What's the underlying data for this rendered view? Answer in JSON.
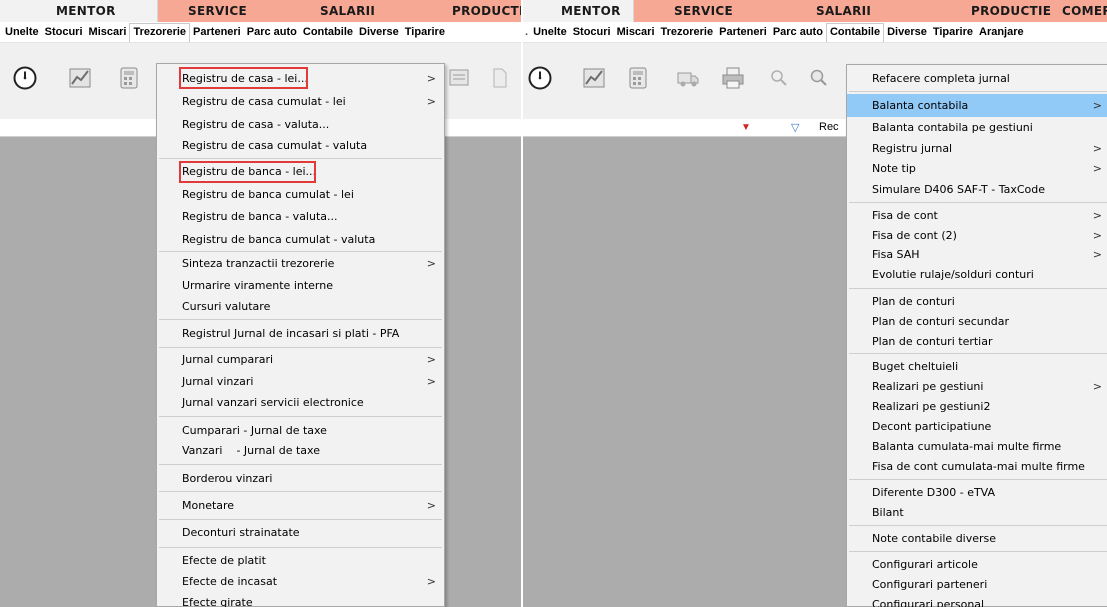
{
  "left": {
    "tabs": [
      {
        "label": "MENTOR",
        "active": true
      },
      {
        "label": "SERVICE",
        "active": false
      },
      {
        "label": "SALARII",
        "active": false
      },
      {
        "label": "PRODUCTIE",
        "active": false
      }
    ],
    "menu": [
      "Unelte",
      "Stocuri",
      "Miscari",
      "Trezorerie",
      "Parteneri",
      "Parc auto",
      "Contabile",
      "Diverse",
      "Tiparire"
    ],
    "open_menu": "Trezorerie",
    "dropdown": [
      {
        "label": "Registru de casa - lei...",
        "submenu": true
      },
      {
        "label": "Registru de casa cumulat - lei",
        "submenu": true
      },
      {
        "label": "Registru de casa - valuta...",
        "submenu": false
      },
      {
        "label": "Registru de casa cumulat - valuta",
        "submenu": false
      },
      {
        "label": "Registru de banca - lei...",
        "submenu": false
      },
      {
        "label": "Registru de banca cumulat - lei",
        "submenu": false
      },
      {
        "label": "Registru de banca - valuta...",
        "submenu": false
      },
      {
        "label": "Registru de banca cumulat - valuta",
        "submenu": false
      },
      {
        "label": "Sinteza tranzactii trezorerie",
        "submenu": true
      },
      {
        "label": "Urmarire viramente interne",
        "submenu": false
      },
      {
        "label": "Cursuri valutare",
        "submenu": false
      },
      {
        "label": "Registrul Jurnal de incasari si plati - PFA",
        "submenu": false
      },
      {
        "label": "Jurnal cumparari",
        "submenu": true
      },
      {
        "label": "Jurnal vinzari",
        "submenu": true
      },
      {
        "label": "Jurnal vanzari servicii electronice",
        "submenu": false
      },
      {
        "label": "Cumparari - Jurnal de taxe",
        "submenu": false
      },
      {
        "label": "Vanzari    - Jurnal de taxe",
        "submenu": false
      },
      {
        "label": "Borderou vinzari",
        "submenu": false
      },
      {
        "label": "Monetare",
        "submenu": true
      },
      {
        "label": "Deconturi strainatate",
        "submenu": false
      },
      {
        "label": "Efecte de platit",
        "submenu": false
      },
      {
        "label": "Efecte de incasat",
        "submenu": true
      },
      {
        "label": "Efecte girate",
        "submenu": false
      }
    ],
    "highlighted_items": [
      "Registru de casa - lei...",
      "Registru de banca - lei..."
    ]
  },
  "right": {
    "tabs": [
      {
        "label": "MENTOR",
        "active": true
      },
      {
        "label": "SERVICE",
        "active": false
      },
      {
        "label": "SALARII",
        "active": false
      },
      {
        "label": "PRODUCTIE",
        "active": false
      },
      {
        "label": "COMERC",
        "active": false
      }
    ],
    "menu": [
      "Unelte",
      "Stocuri",
      "Miscari",
      "Trezorerie",
      "Parteneri",
      "Parc auto",
      "Contabile",
      "Diverse",
      "Tiparire",
      "Aranjare"
    ],
    "open_menu": "Contabile",
    "grid_header_text": "Rec",
    "dropdown": [
      {
        "label": "Refacere completa jurnal",
        "submenu": false
      },
      {
        "label": "Balanta contabila",
        "submenu": true,
        "hover": true
      },
      {
        "label": "Balanta contabila pe gestiuni",
        "submenu": false
      },
      {
        "label": "Registru jurnal",
        "submenu": true
      },
      {
        "label": "Note tip",
        "submenu": true
      },
      {
        "label": "Simulare D406 SAF-T - TaxCode",
        "submenu": false
      },
      {
        "label": "Fisa de cont",
        "submenu": true
      },
      {
        "label": "Fisa de cont (2)",
        "submenu": true
      },
      {
        "label": "Fisa SAH",
        "submenu": true
      },
      {
        "label": "Evolutie rulaje/solduri conturi",
        "submenu": false
      },
      {
        "label": "Plan de conturi",
        "submenu": false
      },
      {
        "label": "Plan de conturi secundar",
        "submenu": false
      },
      {
        "label": "Plan de conturi tertiar",
        "submenu": false
      },
      {
        "label": "Buget cheltuieli",
        "submenu": false
      },
      {
        "label": "Realizari pe gestiuni",
        "submenu": true
      },
      {
        "label": "Realizari pe gestiuni2",
        "submenu": false
      },
      {
        "label": "Decont participatiune",
        "submenu": false
      },
      {
        "label": "Balanta cumulata-mai multe firme",
        "submenu": false
      },
      {
        "label": "Fisa de cont cumulata-mai multe firme",
        "submenu": false
      },
      {
        "label": "Diferente D300 - eTVA",
        "submenu": false
      },
      {
        "label": "Bilant",
        "submenu": false
      },
      {
        "label": "Note contabile diverse",
        "submenu": false
      },
      {
        "label": "Configurari articole",
        "submenu": false
      },
      {
        "label": "Configurari parteneri",
        "submenu": false
      },
      {
        "label": "Configurari personal",
        "submenu": false
      }
    ]
  },
  "colors": {
    "tabbar": "#f6a895",
    "menu_hover": "#91c9f7",
    "annotation_box": "#e03a3a",
    "workspace": "#acacac"
  },
  "icons": [
    "clock-icon",
    "chart-icon",
    "calculator-icon",
    "truck-icon",
    "printer-icon",
    "search-icon",
    "zoom-icon",
    "document-icon",
    "dropdown-arrow-icon",
    "filter-icon"
  ]
}
